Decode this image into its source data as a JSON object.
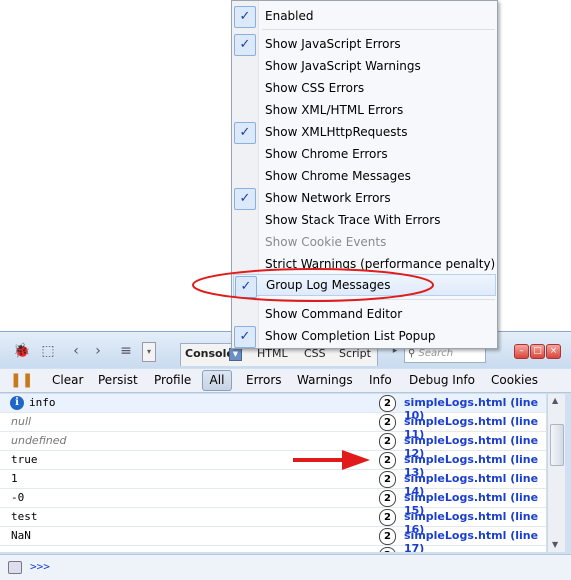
{
  "menu": {
    "items": [
      {
        "label": "Enabled",
        "checked": true,
        "disabled": false
      },
      {
        "label": "Show JavaScript Errors",
        "checked": true,
        "disabled": false
      },
      {
        "label": "Show JavaScript Warnings",
        "checked": false,
        "disabled": false
      },
      {
        "label": "Show CSS Errors",
        "checked": false,
        "disabled": false
      },
      {
        "label": "Show XML/HTML Errors",
        "checked": false,
        "disabled": false
      },
      {
        "label": "Show XMLHttpRequests",
        "checked": true,
        "disabled": false
      },
      {
        "label": "Show Chrome Errors",
        "checked": false,
        "disabled": false
      },
      {
        "label": "Show Chrome Messages",
        "checked": false,
        "disabled": false
      },
      {
        "label": "Show Network Errors",
        "checked": true,
        "disabled": false
      },
      {
        "label": "Show Stack Trace With Errors",
        "checked": false,
        "disabled": false
      },
      {
        "label": "Show Cookie Events",
        "checked": false,
        "disabled": true
      },
      {
        "label": "Strict Warnings (performance penalty)",
        "checked": false,
        "disabled": false
      },
      {
        "label": "Group Log Messages",
        "checked": true,
        "disabled": false
      },
      {
        "label": "Show Command Editor",
        "checked": false,
        "disabled": false
      },
      {
        "label": "Show Completion List Popup",
        "checked": true,
        "disabled": false
      }
    ],
    "check_glyph": "✓"
  },
  "toolbar": {
    "tabs": {
      "console": "Console",
      "html": "HTML",
      "css": "CSS",
      "script": "Script"
    },
    "search_placeholder": "Search"
  },
  "filterbar": {
    "clear": "Clear",
    "persist": "Persist",
    "profile": "Profile",
    "all": "All",
    "errors": "Errors",
    "warnings": "Warnings",
    "info": "Info",
    "debug_info": "Debug Info",
    "cookies": "Cookies"
  },
  "log": {
    "rows": [
      {
        "message": "info",
        "count": "2",
        "source": "simpleLogs.html (line 10)"
      },
      {
        "message": "null",
        "count": "2",
        "source": "simpleLogs.html (line 11)"
      },
      {
        "message": "undefined",
        "count": "2",
        "source": "simpleLogs.html (line 12)"
      },
      {
        "message": "true",
        "count": "2",
        "source": "simpleLogs.html (line 13)"
      },
      {
        "message": "1",
        "count": "2",
        "source": "simpleLogs.html (line 14)"
      },
      {
        "message": "-0",
        "count": "2",
        "source": "simpleLogs.html (line 15)"
      },
      {
        "message": "test",
        "count": "2",
        "source": "simpleLogs.html (line 16)"
      },
      {
        "message": "NaN",
        "count": "2",
        "source": "simpleLogs.html (line 17)"
      }
    ]
  },
  "command_line": {
    "prompt": ">>>"
  },
  "colors": {
    "annotation": "#e11b1b",
    "link": "#1a3fcf"
  }
}
